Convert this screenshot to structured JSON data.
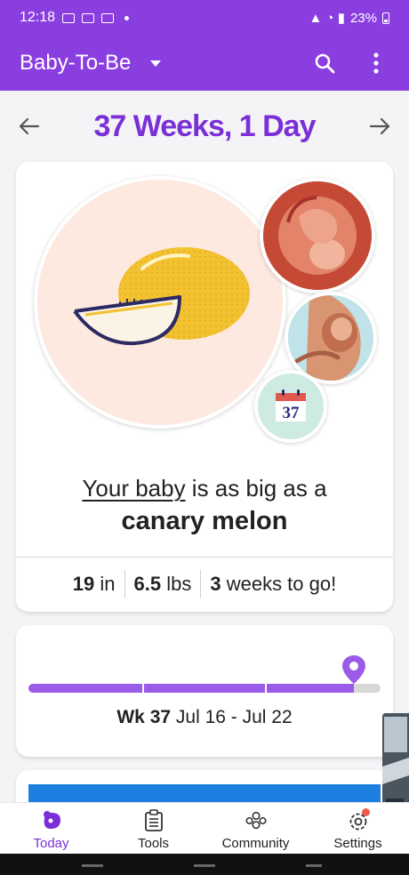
{
  "status_bar": {
    "time": "12:18",
    "battery": "23%"
  },
  "app_bar": {
    "title": "Baby-To-Be"
  },
  "week_header": {
    "title": "37 Weeks, 1 Day"
  },
  "size_card": {
    "line1_link": "Your baby",
    "line1_rest": " is as big as a",
    "fruit": "canary melon",
    "calendar_number": "37",
    "stats": [
      {
        "value": "19",
        "unit": " in"
      },
      {
        "value": "6.5",
        "unit": " lbs"
      },
      {
        "value": "3",
        "unit": " weeks to go!"
      }
    ]
  },
  "timeline": {
    "week_label": "Wk 37",
    "date_range": " Jul 16 - Jul 22",
    "progress": 0.925
  },
  "bottom_nav": [
    {
      "label": "Today",
      "icon": "today-icon",
      "active": true
    },
    {
      "label": "Tools",
      "icon": "tools-icon",
      "active": false
    },
    {
      "label": "Community",
      "icon": "community-icon",
      "active": false
    },
    {
      "label": "Settings",
      "icon": "settings-icon",
      "active": false
    }
  ],
  "colors": {
    "brand": "#8a3ee0",
    "accent": "#7b2fd8",
    "progress": "#9a5ce8",
    "fruit": "#f2c230"
  }
}
